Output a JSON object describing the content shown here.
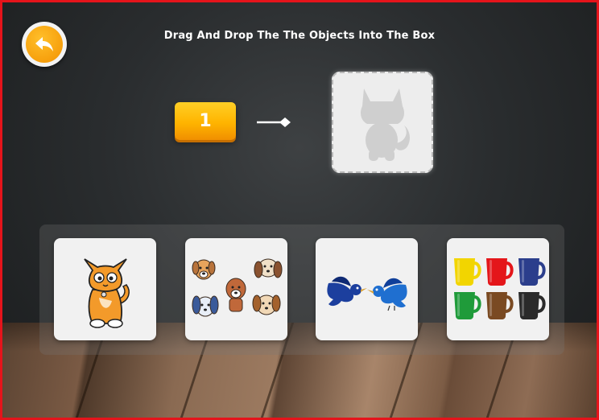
{
  "header": {
    "title": "Drag And Drop The The Objects Into The Box",
    "back_icon": "undo-arrow-icon"
  },
  "target": {
    "count": "1",
    "arrow_icon": "arrow-right-icon",
    "silhouette": "cat-silhouette-icon"
  },
  "options": [
    {
      "name": "cat",
      "icon": "cat-icon"
    },
    {
      "name": "dogs",
      "icon": "dogs-icon"
    },
    {
      "name": "birds",
      "icon": "birds-icon"
    },
    {
      "name": "mugs",
      "icon": "mugs-icon"
    }
  ],
  "colors": {
    "accent": "#f39200",
    "frame": "#e5141b",
    "drop_box": "#ededed",
    "mugs": [
      "#f2d500",
      "#e4161a",
      "#2b3e8c",
      "#1f9b3a",
      "#7a4a22",
      "#2a2a2a"
    ]
  }
}
